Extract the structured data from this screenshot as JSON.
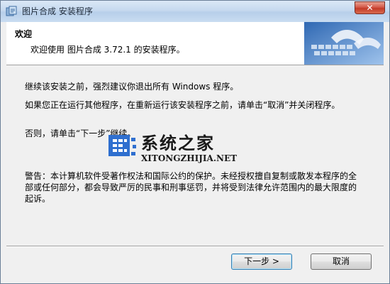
{
  "window": {
    "title": "图片合成 安装程序",
    "close_label": "✕"
  },
  "header": {
    "title": "欢迎",
    "subtitle": "欢迎使用 图片合成 3.72.1 的安装程序。"
  },
  "body": {
    "paragraphs": [
      "继续该安装之前，强烈建议你退出所有 Windows 程序。",
      "如果您正在运行其他程序，在重新运行该安装程序之前，请单击“取消”并关闭程序。",
      "否则，请单击“下一步”继续。",
      "警告：本计算机软件受著作权法和国际公约的保护。未经授权擅自复制或散发本程序的全部或任何部分，都会导致严厉的民事和刑事惩罚，并将受到法律允许范围内的最大限度的起诉。"
    ]
  },
  "watermark": {
    "name": "系统之家",
    "url": "XITONGZHIJIA.NET"
  },
  "buttons": {
    "next": "下一步 >",
    "cancel": "取消"
  },
  "colors": {
    "titlebar": "#c6d9ef",
    "close": "#c33a28",
    "dialog_bg": "#f0f0f0",
    "header_bg": "#ffffff",
    "accent": "#3c7fb1"
  },
  "icons": [
    "installer-icon",
    "close-icon",
    "keyboard-header-image",
    "site-logo-icon"
  ]
}
